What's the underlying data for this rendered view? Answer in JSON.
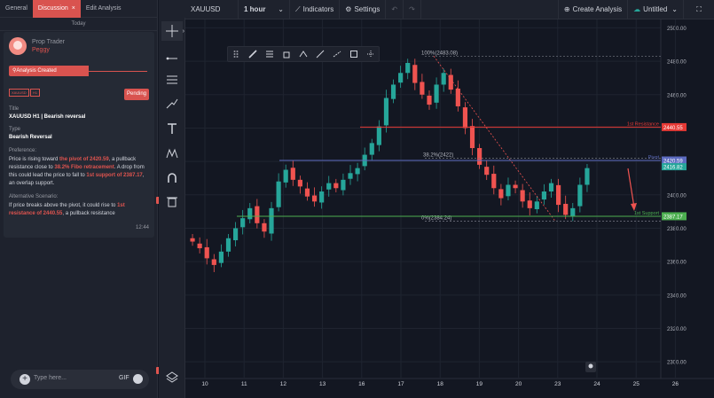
{
  "tabs": [
    {
      "label": "General"
    },
    {
      "label": "Discussion",
      "close": "×"
    },
    {
      "label": "Edit Analysis"
    }
  ],
  "today": "Today",
  "card": {
    "role": "Prop Trader",
    "user": "Peggy",
    "event": "Analysis Created",
    "chips": [
      "XAUUSD",
      "H1"
    ],
    "status": "Pending",
    "title_label": "Title",
    "title": "XAUUSD H1 | Bearish reversal",
    "type_label": "Type",
    "type": "Bearish Reversal",
    "pref_label": "Preference:",
    "pref": [
      {
        "t": "Price is rising toward ",
        "h": false
      },
      {
        "t": "the pivot of 2420.59",
        "h": true
      },
      {
        "t": ", a pullback resistance close to ",
        "h": false
      },
      {
        "t": "38.2% Fibo retracement",
        "h": true
      },
      {
        "t": ". A drop from this could lead the price to fall to ",
        "h": false
      },
      {
        "t": "1st support of 2387.17",
        "h": true
      },
      {
        "t": ", an overlap support.",
        "h": false
      }
    ],
    "alt_label": "Alternative Scenario:",
    "alt": [
      {
        "t": "If price  breaks above the pivot, it could rise to ",
        "h": false
      },
      {
        "t": "1st resistance of 2440.55",
        "h": true
      },
      {
        "t": ", a pullback resistance",
        "h": false
      }
    ],
    "time": "12:44"
  },
  "composer": {
    "placeholder": "Type here...",
    "gif": "GIF"
  },
  "toolbar": {
    "symbol": "XAUUSD",
    "interval": "1 hour",
    "indicators": "Indicators",
    "settings": "Settings",
    "create": "Create Analysis",
    "layout": "Untitled"
  },
  "icons": [
    "crosshair-icon",
    "trend-line-icon",
    "horizontal-lines-icon",
    "brush-icon",
    "text-icon",
    "pattern-icon",
    "magnet-icon",
    "trash-icon",
    "layers-icon"
  ],
  "colors": {
    "accent": "#d9534f",
    "bull": "#26a69a",
    "bear": "#ef5350",
    "support": "#4caf50",
    "resistance": "#e53935",
    "pivot": "#5c6bc0"
  },
  "chart_data": {
    "type": "candlestick",
    "symbol": "XAUUSD",
    "interval": "1 hour",
    "ylim": [
      2290,
      2505
    ],
    "yticks": [
      2300,
      2320,
      2340,
      2360,
      2380,
      2400,
      2420,
      2440,
      2460,
      2480,
      2500
    ],
    "xticks": [
      "10",
      "11",
      "12",
      "13",
      "16",
      "17",
      "18",
      "19",
      "20",
      "23",
      "24",
      "25",
      "26"
    ],
    "close_path": [
      2372,
      2368,
      2362,
      2358,
      2366,
      2374,
      2380,
      2386,
      2392,
      2383,
      2378,
      2392,
      2408,
      2415,
      2409,
      2405,
      2399,
      2396,
      2402,
      2407,
      2404,
      2409,
      2413,
      2416,
      2424,
      2431,
      2441,
      2458,
      2466,
      2473,
      2479,
      2467,
      2460,
      2454,
      2466,
      2473,
      2463,
      2453,
      2440,
      2428,
      2418,
      2412,
      2404,
      2398,
      2406,
      2404,
      2396,
      2392,
      2396,
      2402,
      2407,
      2394,
      2388,
      2392,
      2406,
      2416
    ],
    "levels": [
      {
        "name": "1st Resistance",
        "value": 2440.55,
        "label": "2440.55"
      },
      {
        "name": "Pivot",
        "value": 2420.59,
        "label": "2420.59"
      },
      {
        "name": "1st Support",
        "value": 2387.17,
        "label": "2387.17"
      }
    ],
    "last_price": "2416.82",
    "fib": [
      {
        "label": "100%(2483.08)",
        "value": 2483.08
      },
      {
        "label": "38.2%(2422)",
        "value": 2422
      },
      {
        "label": "0%(2384.24)",
        "value": 2384.24
      }
    ],
    "grid": true
  }
}
